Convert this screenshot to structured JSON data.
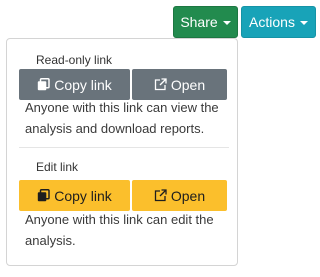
{
  "toolbar": {
    "share_label": "Share",
    "actions_label": "Actions"
  },
  "share_menu": {
    "readonly": {
      "heading": "Read-only link",
      "copy_label": "Copy link",
      "open_label": "Open",
      "description": "Anyone with this link can view the analysis and download reports."
    },
    "edit": {
      "heading": "Edit link",
      "copy_label": "Copy link",
      "open_label": "Open",
      "description": "Anyone with this link can edit the analysis."
    }
  },
  "colors": {
    "share_green": "#228b4e",
    "actions_teal": "#18a3b8",
    "readonly_gray": "#69737b",
    "edit_yellow": "#fbbf2c"
  },
  "icons": {
    "copy": "copy-icon",
    "open": "external-link-icon",
    "caret": "caret-down-icon"
  }
}
